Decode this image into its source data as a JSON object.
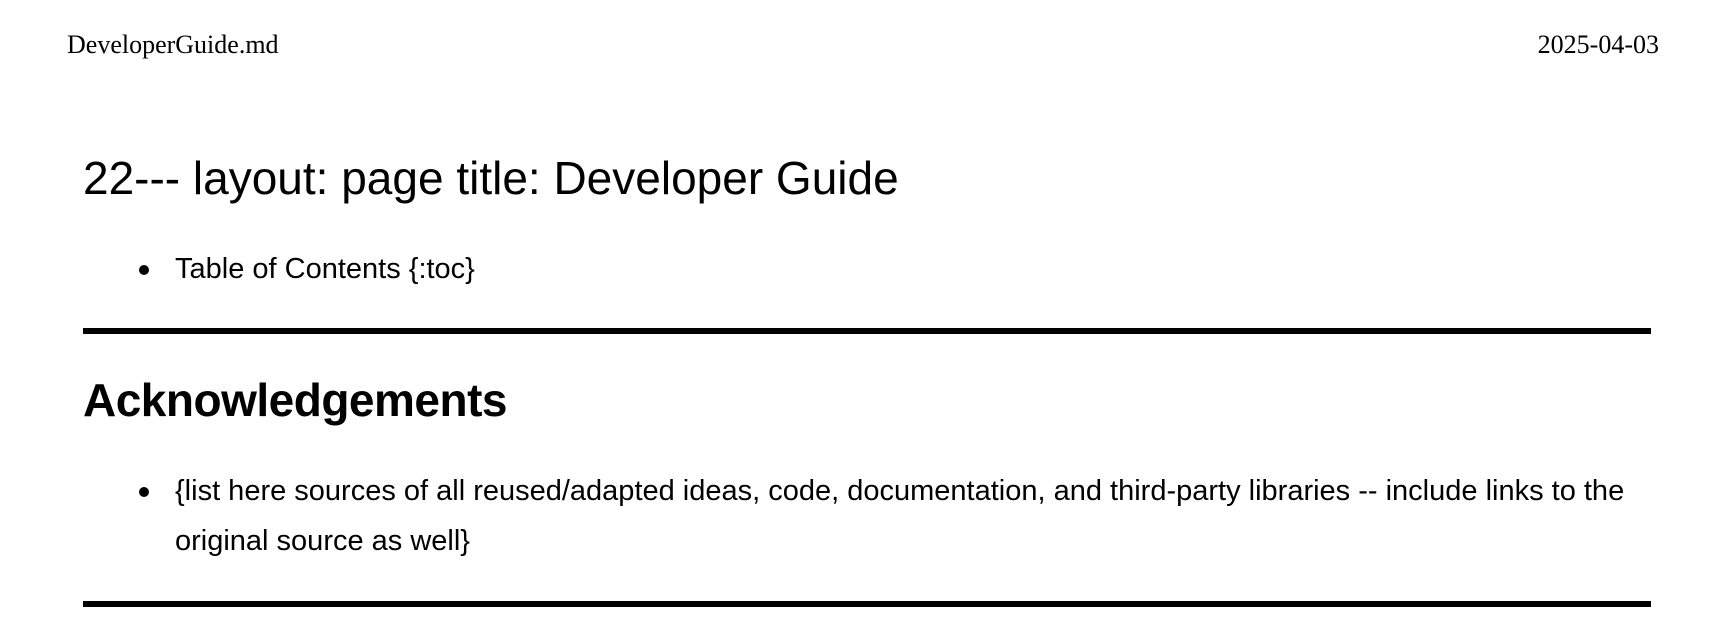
{
  "header": {
    "filename": "DeveloperGuide.md",
    "date": "2025-04-03"
  },
  "document": {
    "title": "22--- layout: page title: Developer Guide",
    "toc_items": [
      "Table of Contents {:toc}"
    ],
    "sections": [
      {
        "heading": "Acknowledgements",
        "items": [
          "{list here sources of all reused/adapted ideas, code, documentation, and third-party libraries -- include links to the original source as well}"
        ]
      }
    ]
  }
}
